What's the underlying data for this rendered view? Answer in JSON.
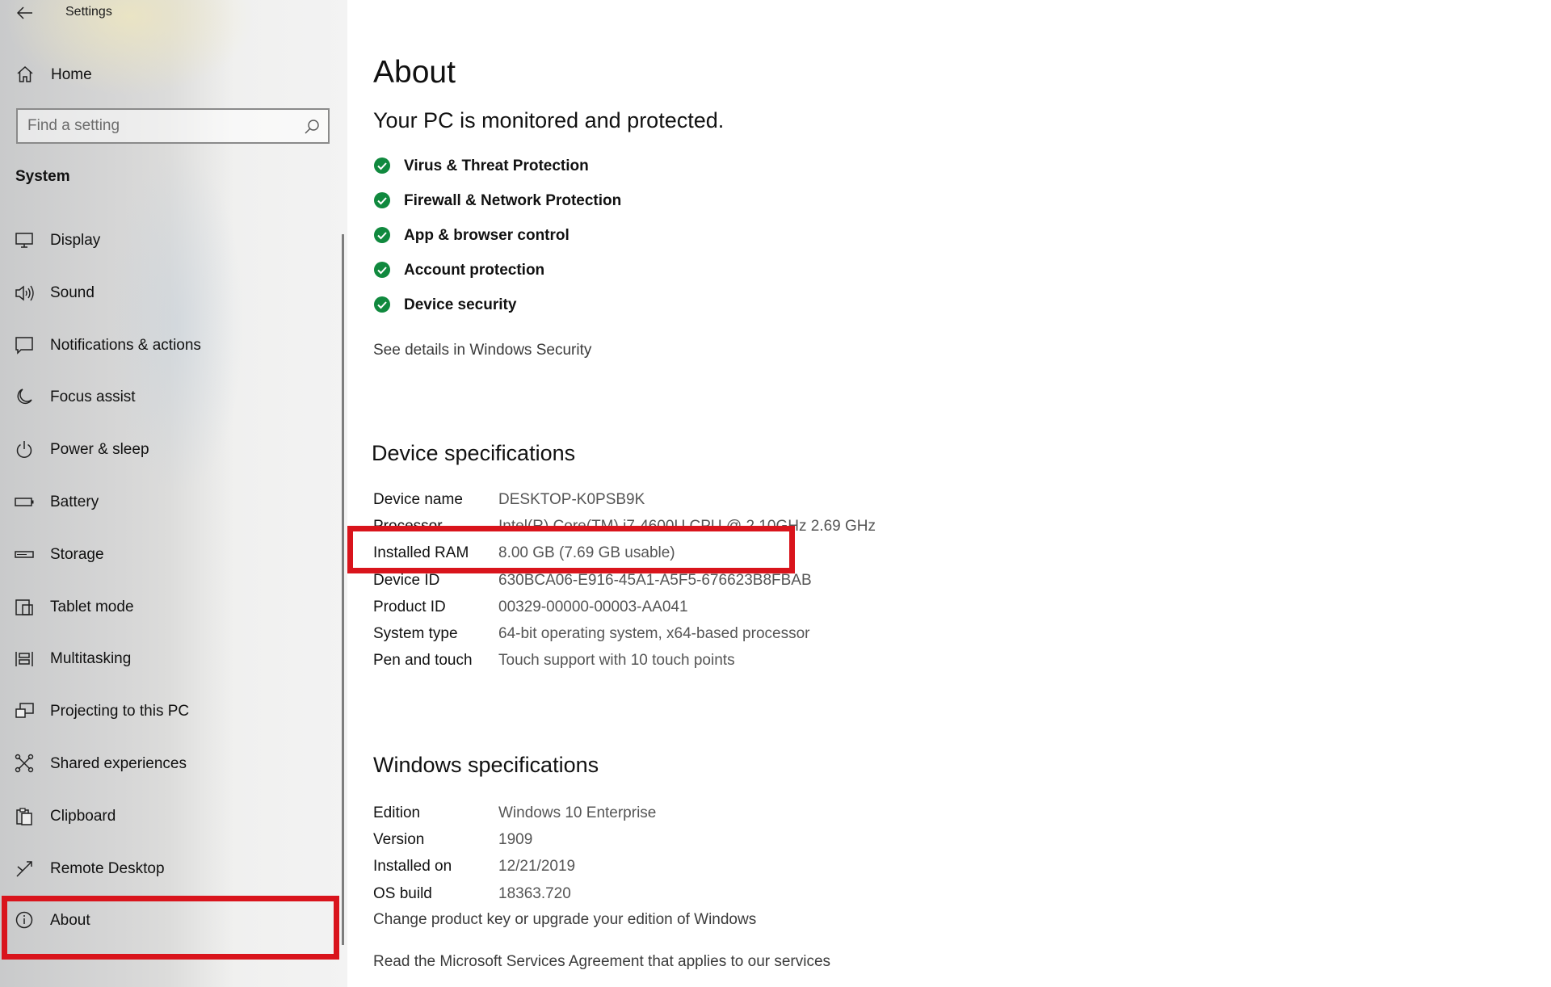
{
  "window": {
    "title": "Settings"
  },
  "sidebar": {
    "home_label": "Home",
    "search_placeholder": "Find a setting",
    "section_label": "System",
    "items": [
      {
        "label": "Display",
        "icon": "monitor-icon"
      },
      {
        "label": "Sound",
        "icon": "speaker-icon"
      },
      {
        "label": "Notifications & actions",
        "icon": "notification-icon"
      },
      {
        "label": "Focus assist",
        "icon": "moon-icon"
      },
      {
        "label": "Power & sleep",
        "icon": "power-icon"
      },
      {
        "label": "Battery",
        "icon": "battery-icon"
      },
      {
        "label": "Storage",
        "icon": "storage-icon"
      },
      {
        "label": "Tablet mode",
        "icon": "tablet-mode-icon"
      },
      {
        "label": "Multitasking",
        "icon": "multitasking-icon"
      },
      {
        "label": "Projecting to this PC",
        "icon": "projecting-icon"
      },
      {
        "label": "Shared experiences",
        "icon": "shared-experiences-icon"
      },
      {
        "label": "Clipboard",
        "icon": "clipboard-icon"
      },
      {
        "label": "Remote Desktop",
        "icon": "remote-desktop-icon"
      },
      {
        "label": "About",
        "icon": "info-icon",
        "selected": true
      }
    ]
  },
  "main": {
    "title": "About",
    "protection": {
      "heading": "Your PC is monitored and protected.",
      "items": [
        "Virus & Threat Protection",
        "Firewall & Network Protection",
        "App & browser control",
        "Account protection",
        "Device security"
      ],
      "details_link": "See details in Windows Security"
    },
    "device_specs": {
      "heading": "Device specifications",
      "rows": [
        {
          "key": "Device name",
          "value": "DESKTOP-K0PSB9K"
        },
        {
          "key": "Processor",
          "value": "Intel(R) Core(TM) i7-4600U CPU @ 2.10GHz   2.69 GHz"
        },
        {
          "key": "Installed RAM",
          "value": "8.00 GB (7.69 GB usable)"
        },
        {
          "key": "Device ID",
          "value": "630BCA06-E916-45A1-A5F5-676623B8FBAB"
        },
        {
          "key": "Product ID",
          "value": "00329-00000-00003-AA041"
        },
        {
          "key": "System type",
          "value": "64-bit operating system, x64-based processor"
        },
        {
          "key": "Pen and touch",
          "value": "Touch support with 10 touch points"
        }
      ]
    },
    "windows_specs": {
      "heading": "Windows specifications",
      "rows": [
        {
          "key": "Edition",
          "value": "Windows 10 Enterprise"
        },
        {
          "key": "Version",
          "value": "1909"
        },
        {
          "key": "Installed on",
          "value": "12/21/2019"
        },
        {
          "key": "OS build",
          "value": "18363.720"
        }
      ],
      "product_key_link": "Change product key or upgrade your edition of Windows",
      "services_link": "Read the Microsoft Services Agreement that applies to our services"
    }
  },
  "colors": {
    "highlight": "#d9141c",
    "check": "#10893e"
  }
}
